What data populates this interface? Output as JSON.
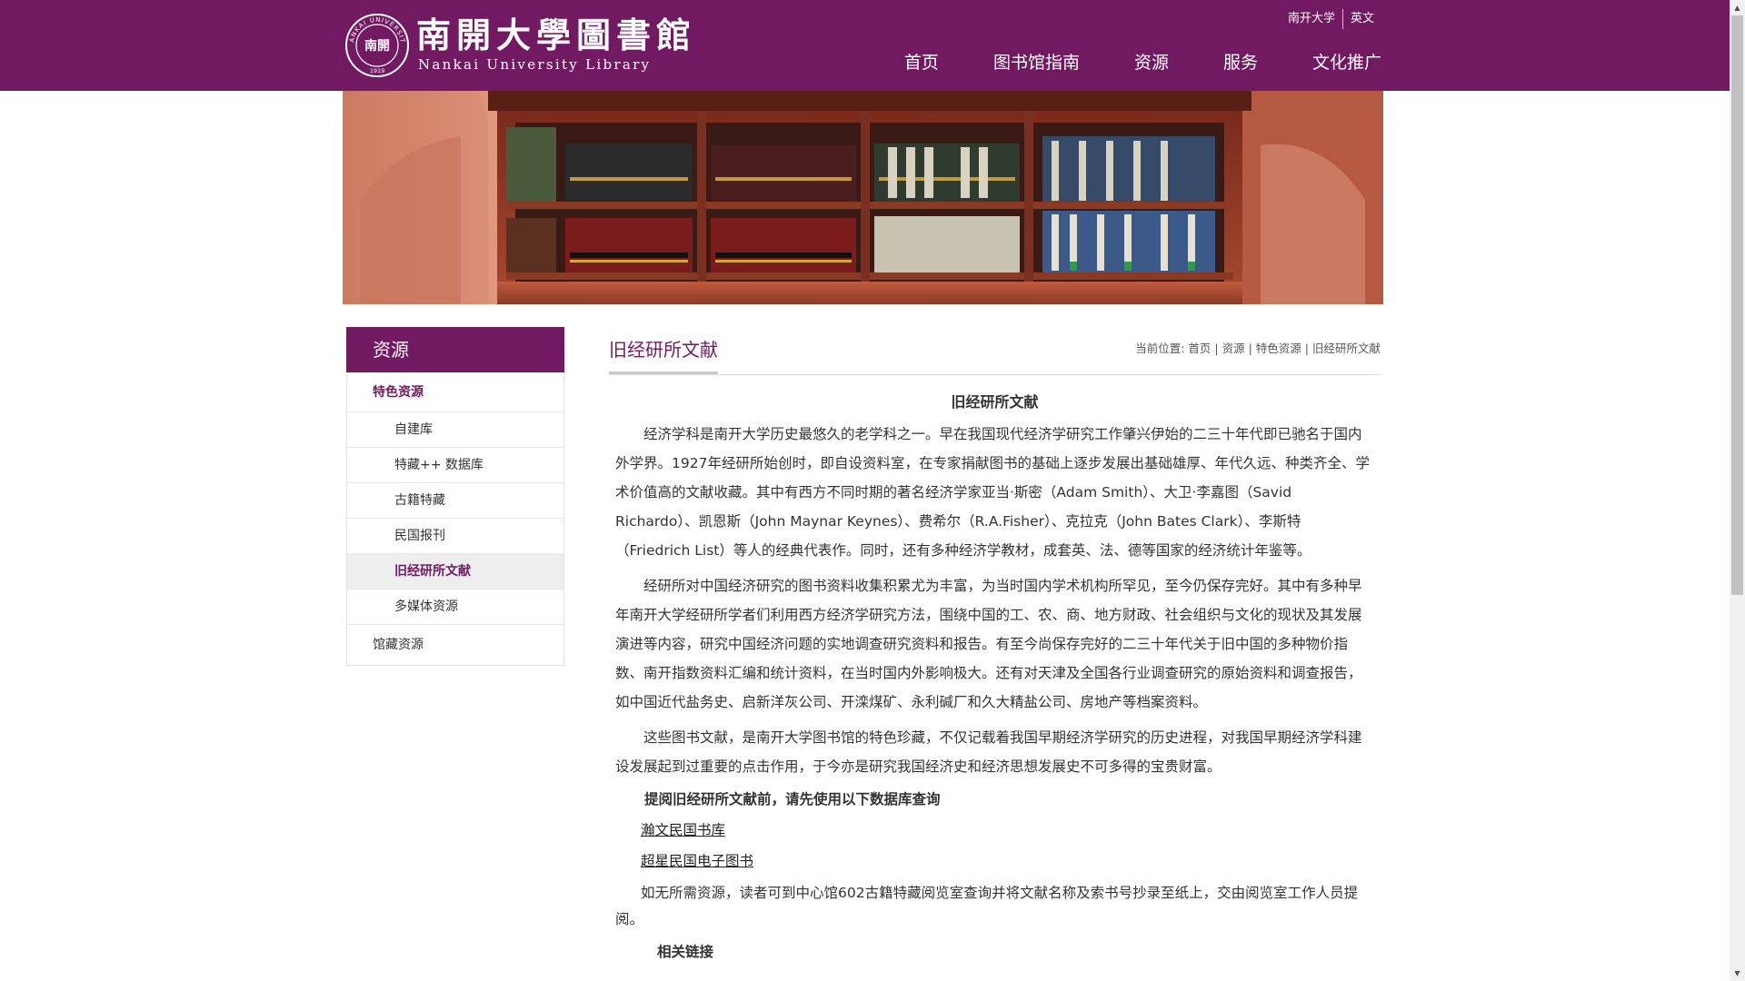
{
  "header": {
    "logo_cn": "南開大學圖書館",
    "logo_en": "Nankai University Library",
    "seal_outer_text": "NANKAI UNIVERSITY",
    "seal_center": "南開",
    "seal_year": "1919",
    "toplinks": [
      "南开大学",
      "英文"
    ],
    "nav": [
      "首页",
      "图书馆指南",
      "资源",
      "服务",
      "文化推广"
    ]
  },
  "banner": {
    "alt": ""
  },
  "sidebar": {
    "title": "资源",
    "items": [
      {
        "label": "特色资源",
        "level": 1,
        "state": "active"
      },
      {
        "label": "自建库",
        "level": 2
      },
      {
        "label": "特藏++ 数据库",
        "level": 2
      },
      {
        "label": "古籍特藏",
        "level": 2
      },
      {
        "label": "民国报刊",
        "level": 2
      },
      {
        "label": "旧经研所文献",
        "level": 2,
        "state": "selected"
      },
      {
        "label": "多媒体资源",
        "level": 2
      },
      {
        "label": "馆藏资源",
        "level": 1
      }
    ]
  },
  "content": {
    "title": "旧经研所文献",
    "breadcrumb": {
      "prefix": "当前位置:",
      "items": [
        "首页",
        "资源",
        "特色资源",
        "旧经研所文献"
      ],
      "separator": " | "
    }
  },
  "article": {
    "title": "旧经研所文献",
    "paragraphs": [
      "经济学科是南开大学历史最悠久的老学科之一。早在我国现代经济学研究工作肇兴伊始的二三十年代即已驰名于国内外学界。1927年经研所始创时，即自设资料室，在专家捐献图书的基础上逐步发展出基础雄厚、年代久远、种类齐全、学术价值高的文献收藏。其中有西方不同时期的著名经济学家亚当·斯密（Adam Smith）、大卫·李嘉图（Savid Richardo）、凯恩斯（John Maynar Keynes）、费希尔（R.A.Fisher）、克拉克（John Bates Clark）、李斯特（Friedrich List）等人的经典代表作。同时，还有多种经济学教材，成套英、法、德等国家的经济统计年鉴等。",
      "经研所对中国经济研究的图书资料收集积累尤为丰富，为当时国内学术机构所罕见，至今仍保存完好。其中有多种早年南开大学经研所学者们利用西方经济学研究方法，围绕中国的工、农、商、地方财政、社会组织与文化的现状及其发展演进等内容，研究中国经济问题的实地调查研究资料和报告。有至今尚保存完好的二三十年代关于旧中国的多种物价指数、南开指数资料汇编和统计资料，在当时国内外影响极大。还有对天津及全国各行业调查研究的原始资料和调查报告，如中国近代盐务史、启新洋灰公司、开滦煤矿、永利碱厂和久大精盐公司、房地产等档案资料。",
      "这些图书文献，是南开大学图书馆的特色珍藏，不仅记载着我国早期经济学研究的历史进程，对我国早期经济学科建设发展起到过重要的点击作用，于今亦是研究我国经济史和经济思想发展史不可多得的宝贵财富。"
    ],
    "query_heading": "提阅旧经研所文献前，请先使用以下数据库查询",
    "db_links": [
      "瀚文民国书库",
      "超星民国电子图书"
    ],
    "note": "如无所需资源，读者可到中心馆602古籍特藏阅览室查询并将文献名称及索书号抄录至纸上，交由阅览室工作人员提阅。",
    "related_heading": "相关链接"
  },
  "colors": {
    "brand": "#721a61",
    "selected_bg": "#eeeeee"
  }
}
